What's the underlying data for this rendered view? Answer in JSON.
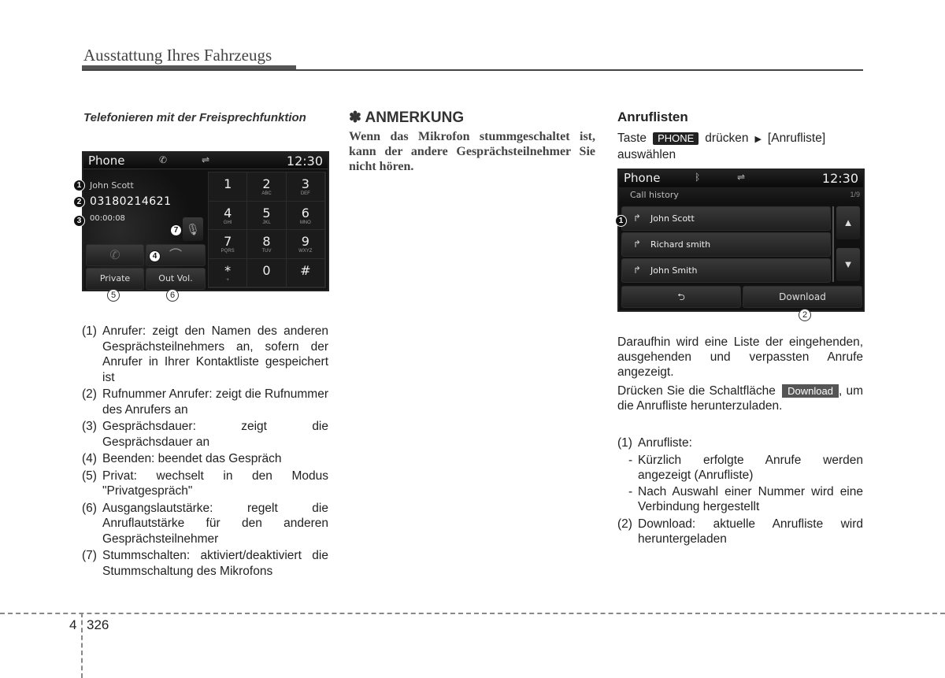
{
  "header": {
    "title": "Ausstattung Ihres Fahrzeugs"
  },
  "left": {
    "section_title": "Telefonieren mit der Freisprechfunktion",
    "screen": {
      "app_title": "Phone",
      "time": "12:30",
      "icons": [
        "handset-icon",
        "usb-icon"
      ],
      "caller_name": "John Scott",
      "caller_number": "03180214621",
      "call_duration": "00:00:08",
      "buttons": {
        "private": "Private",
        "out_vol": "Out Vol."
      },
      "keypad": [
        {
          "digit": "1",
          "letters": ""
        },
        {
          "digit": "2",
          "letters": "ABC"
        },
        {
          "digit": "3",
          "letters": "DEF"
        },
        {
          "digit": "4",
          "letters": "GHI"
        },
        {
          "digit": "5",
          "letters": "JKL"
        },
        {
          "digit": "6",
          "letters": "MNO"
        },
        {
          "digit": "7",
          "letters": "PQRS"
        },
        {
          "digit": "8",
          "letters": "TUV"
        },
        {
          "digit": "9",
          "letters": "WXYZ"
        },
        {
          "digit": "*",
          "letters": "+"
        },
        {
          "digit": "0",
          "letters": ""
        },
        {
          "digit": "#",
          "letters": ""
        }
      ],
      "callouts": [
        "1",
        "2",
        "3",
        "4",
        "5",
        "6",
        "7"
      ]
    },
    "descriptions": [
      {
        "num": "(1)",
        "text": "Anrufer: zeigt den Namen des anderen Gesprächsteilnehmers an, sofern der Anrufer in Ihrer Kontaktliste gespeichert ist"
      },
      {
        "num": "(2)",
        "text": "Rufnummer Anrufer: zeigt die Rufnummer des Anrufers an"
      },
      {
        "num": "(3)",
        "text": "Gesprächsdauer: zeigt die Gesprächsdauer an"
      },
      {
        "num": "(4)",
        "text": "Beenden: beendet das Gespräch"
      },
      {
        "num": "(5)",
        "text": "Privat: wechselt in den Modus \"Privatgespräch\""
      },
      {
        "num": "(6)",
        "text": "Ausgangslautstärke: regelt die Anruflautstärke für den anderen Gesprächsteilnehmer"
      },
      {
        "num": "(7)",
        "text": "Stummschalten: aktiviert/deaktiviert die Stummschaltung des Mikrofons"
      }
    ]
  },
  "middle": {
    "note_title": "✽ ANMERKUNG",
    "note_text": "Wenn das Mikrofon stummgeschaltet ist, kann der andere Gesprächsteilnehmer Sie nicht hören."
  },
  "right": {
    "section_title": "Anruflisten",
    "intro": {
      "pre": "Taste",
      "key": "PHONE",
      "mid": "drücken",
      "arrow": "▶",
      "post": "[Anrufliste] auswählen"
    },
    "screen": {
      "app_title": "Phone",
      "time": "12:30",
      "subtitle": "Call history",
      "page": "1/9",
      "items": [
        "John Scott",
        "Richard smith",
        "John Smith"
      ],
      "download_label": "Download",
      "callouts": [
        "1",
        "2"
      ]
    },
    "para1": "Daraufhin wird eine Liste der eingehenden, ausgehenden und verpassten Anrufe angezeigt.",
    "para2_pre": "Drücken Sie die Schaltfläche",
    "para2_button": "Download",
    "para2_post": ", um die Anrufliste herunterzuladen.",
    "list": {
      "item1_num": "(1)",
      "item1_title": "Anrufliste:",
      "item1_subs": [
        "Kürzlich erfolgte Anrufe werden angezeigt (Anrufliste)",
        "Nach Auswahl einer Nummer wird eine Verbindung hergestellt"
      ],
      "item2_num": "(2)",
      "item2_text": "Download: aktuelle Anrufliste wird heruntergeladen"
    }
  },
  "footer": {
    "chapter": "4",
    "page": "326"
  }
}
